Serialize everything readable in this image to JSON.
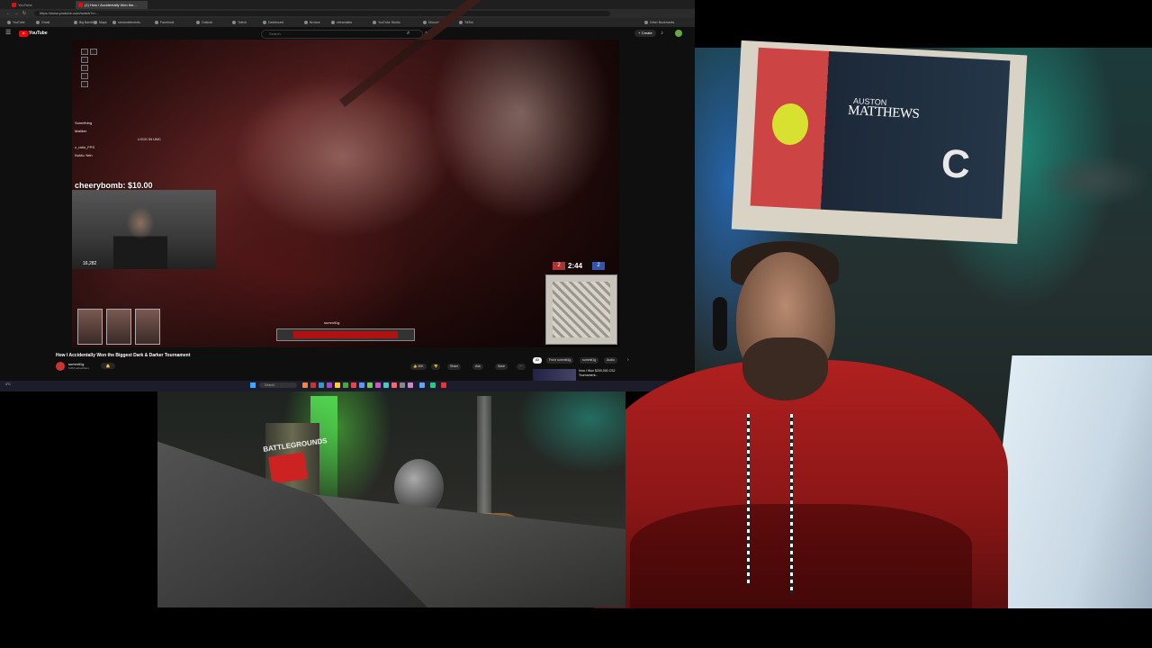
{
  "browser": {
    "tabs": [
      "YouTube",
      "(1) How I Accidentally Won the..."
    ],
    "url": "https://www.youtube.com/watch?v=...",
    "bookmarks": [
      "YouTube",
      "Gmail",
      "Big Bandit",
      "Maps",
      "streamelements",
      "Facebook",
      "Outlook",
      "Twitch",
      "Dashboard",
      "Browse",
      "streamlabs",
      "YouTube Studio",
      "Discord",
      "TikTok",
      "Other Bookmarks"
    ]
  },
  "youtube": {
    "brand": "YouTube",
    "search_placeholder": "Search",
    "create_label": "+ Create",
    "video_title": "How I Accidentally Won the Biggest Dark & Darker Tournament",
    "channel_name": "summit1g",
    "channel_subs": "6.6M subscribers",
    "actions": [
      "👍 40K",
      "👎",
      "Share",
      "Ask",
      "Save",
      "···"
    ],
    "chips": [
      "All",
      "From summit1g",
      "summit1g",
      "Audio"
    ],
    "rec_title": "How I Won $200,000 CS2 Tournament..."
  },
  "stream_overlay": {
    "chat": [
      "Something",
      "Mattker",
      "LOCK IN UNC",
      "c_ratio_FPS",
      "NoMo Yeth"
    ],
    "donation": "cheerybomb: $10.00",
    "viewer_count": "16,282",
    "player_name": "summit1g",
    "team_a_score": "2",
    "match_time": "2:44",
    "team_b_score": "2"
  },
  "taskbar": {
    "search": "Search",
    "weather": "4°C",
    "clock": "1:24 AM"
  },
  "poster": {
    "name_top": "AUSTON",
    "name": "MATTHEWS",
    "letter": "C"
  },
  "desk": {
    "can_label": "BATTLEGROUNDS"
  },
  "colors": {
    "youtube_red": "#ff0000",
    "hoodie": "#b02020",
    "hp_bar": "#b01212"
  }
}
